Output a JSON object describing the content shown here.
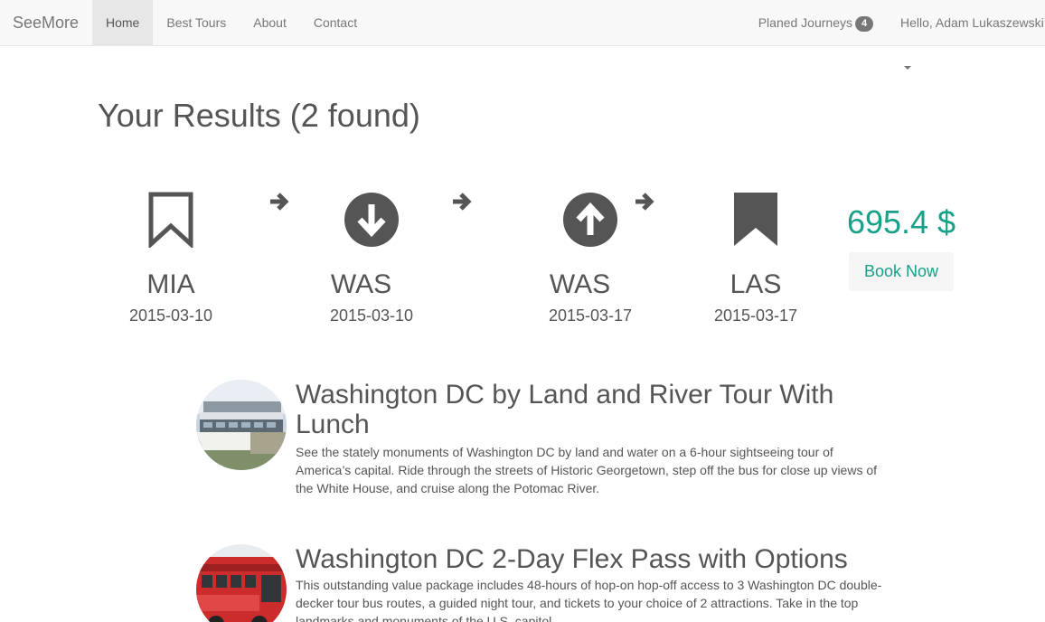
{
  "navbar": {
    "brand": "SeeMore",
    "links": [
      {
        "label": "Home",
        "active": true
      },
      {
        "label": "Best Tours",
        "active": false
      },
      {
        "label": "About",
        "active": false
      },
      {
        "label": "Contact",
        "active": false
      }
    ],
    "journeys_label": "Planed Journeys",
    "journeys_count": "4",
    "user_greeting": "Hello, Adam Lukaszewski"
  },
  "results": {
    "title": "Your Results (2 found)"
  },
  "itinerary": {
    "stops": [
      {
        "code": "MIA",
        "date": "2015-03-10",
        "icon": "bookmark-outline-icon"
      },
      {
        "code": "WAS",
        "date": "2015-03-10",
        "icon": "arrow-circle-down-icon"
      },
      {
        "code": "WAS",
        "date": "2015-03-17",
        "icon": "arrow-circle-up-icon"
      },
      {
        "code": "LAS",
        "date": "2015-03-17",
        "icon": "bookmark-solid-icon"
      }
    ],
    "price": "695.4 $",
    "book_label": "Book Now",
    "accent_color": "#18a188"
  },
  "tours": [
    {
      "title": "Washington DC by Land and River Tour With Lunch",
      "description": "See the stately monuments of Washington DC by land and water on a 6-hour sightseeing tour of America’s capital. Ride through the streets of Historic Georgetown, step off the bus for close up views of the White House, and cruise along the Potomac River."
    },
    {
      "title": "Washington DC 2-Day Flex Pass with Options",
      "description": "This outstanding value package includes 48-hours of hop-on hop-off access to 3 Washington DC double-decker tour bus routes, a guided night tour, and tickets to your choice of 2 attractions. Take in the top landmarks and monuments of the U.S. capitol"
    }
  ]
}
